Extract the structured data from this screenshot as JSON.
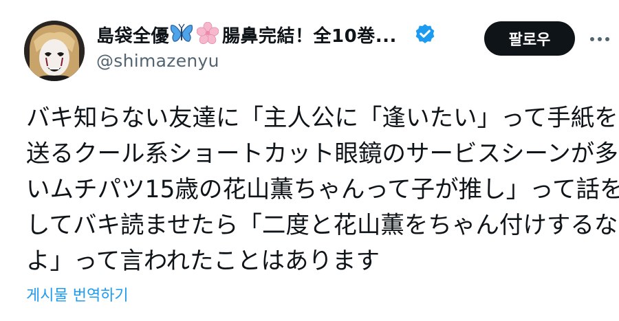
{
  "author": {
    "display_name_prefix": "島袋全優",
    "display_name_suffix": "腸鼻完結！全10巻...",
    "emoji_1": "butterfly-emoji",
    "emoji_2": "cherry-blossom-emoji",
    "handle": "@shimazenyu",
    "verified": true,
    "verified_color": "#1d9bf0"
  },
  "follow_button": {
    "label": "팔로우",
    "bg_color": "#0f1419",
    "text_color": "#ffffff"
  },
  "more_button": {
    "icon": "more-horizontal-icon"
  },
  "tweet": {
    "lines": [
      "バキ知らない友達に「主人公に「逢いたい」って手紙を",
      "送るクール系ショートカット眼鏡のサービスシーンが多",
      "いムチパツ15歳の花山薫ちゃんって子が推し」って話を",
      "してバキ読ませたら「二度と花山薫をちゃん付けするな",
      "よ」って言われたことはあります"
    ]
  },
  "translate_link": {
    "label": "게시물 번역하기",
    "color": "#1d9bf0"
  }
}
